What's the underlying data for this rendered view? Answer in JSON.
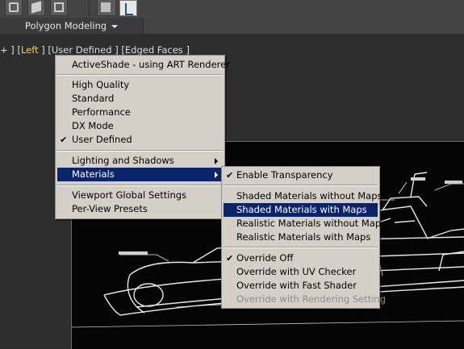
{
  "toolbar": {
    "tab_label": "Polygon Modeling",
    "icons": [
      "shape-icon",
      "cube-icon",
      "component-icon",
      "paint-icon",
      "toolbar-pin-icon"
    ]
  },
  "viewport": {
    "label_plus": "+",
    "label_left": "Left",
    "label_user_defined": "User Defined",
    "label_edged_faces": "Edged Faces"
  },
  "menu": {
    "activeshade": "ActiveShade - using ART Renderer",
    "high_quality": "High Quality",
    "standard": "Standard",
    "performance": "Performance",
    "dx_mode": "DX Mode",
    "user_defined": "User Defined",
    "lighting_shadows": "Lighting and Shadows",
    "materials": "Materials",
    "viewport_global": "Viewport Global Settings",
    "per_view": "Per-View Presets"
  },
  "submenu": {
    "enable_transparency": "Enable Transparency",
    "shaded_without_maps": "Shaded Materials without Maps",
    "shaded_with_maps": "Shaded Materials with Maps",
    "realistic_without_maps": "Realistic Materials without Maps",
    "realistic_with_maps": "Realistic Materials with Maps",
    "override_off": "Override Off",
    "override_uv": "Override with UV Checker",
    "override_fast": "Override with Fast Shader",
    "override_rendering": "Override with Rendering Setting"
  },
  "colors": {
    "menu_bg": "#d4d0c8",
    "selected_bg": "#0a246a",
    "viewport_label_highlight": "#f1d24a"
  }
}
